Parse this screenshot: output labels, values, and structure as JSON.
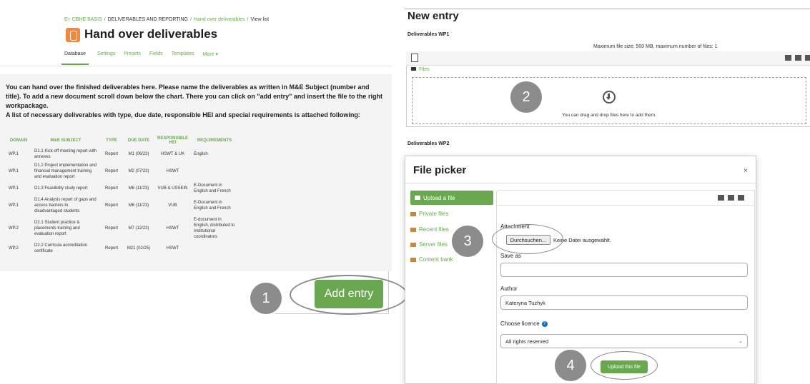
{
  "left": {
    "breadcrumb": [
      "E+ CBHE BASIS",
      "DELIVERABLES AND REPORTING",
      "Hand over deliverables",
      "View list"
    ],
    "breadcrumb_sep": "/",
    "title": "Hand over deliverables",
    "tabs": [
      "Database",
      "Settings",
      "Presets",
      "Fields",
      "Templates",
      "More ▾"
    ],
    "intro_p1": "You can hand over the finished deliverables here. Please name the deliverables as written in M&E Subject (number and title). To add a new document scroll down below the chart. There you can click on \"add entry\" and insert the file to the right workpackage.",
    "intro_p2": "A list of necessary deliverables with type, due date, responsible HEI and special requirements is attached following:",
    "table": {
      "headers": [
        "DOMAIN",
        "M&E SUBJECT",
        "TYPE",
        "DUE DATE",
        "RESPONSIBLE HEI",
        "REQUIREMENTS"
      ],
      "rows": [
        [
          "WP.1",
          "D1.1 Kick-off meeting report with annexes",
          "Report",
          "M1 (06/23)",
          "HSWT & UK",
          "English"
        ],
        [
          "WP.1",
          "D1.2 Project implementation and financial management training and evaluation report",
          "Report",
          "M2 (07/23)",
          "HSWT",
          ""
        ],
        [
          "WP.1",
          "D1.3 Feasibility study report",
          "Report",
          "M6 (11/23)",
          "VUB & USSEIN",
          "E-Document in English and French"
        ],
        [
          "WP.1",
          "D1.4 Analysis report of gaps and access barriers to disadvantaged students",
          "Report",
          "M6 (11/23)",
          "VUB",
          "E-Document in English and French"
        ],
        [
          "WP.2",
          "D2.1 Student practice & placements training and evaluation report",
          "Report",
          "M7 (12/23)",
          "HSWT",
          "E-document in English, distributed to institutional coordinators"
        ],
        [
          "WP.2",
          "D2.2 Curricula accreditation certificate",
          "Report",
          "M21 (02/25)",
          "HSWT",
          ""
        ]
      ]
    },
    "add_entry_label": "Add entry"
  },
  "steps": [
    "1",
    "2",
    "3",
    "4"
  ],
  "right": {
    "title": "New entry",
    "wp1_label": "Deliverables WP1",
    "max_size": "Maximum file size: 500 MB, maximum number of files: 1",
    "files_folder": "Files",
    "drop_text": "You can drag and drop files here to add them.",
    "wp2_label": "Deliverables WP2"
  },
  "file_picker": {
    "title": "File picker",
    "close": "×",
    "sidebar": [
      "Upload a file",
      "Private files",
      "Recent files",
      "Server files",
      "Content bank"
    ],
    "attachment_label": "Attachment",
    "choose_button": "Durchsuchen...",
    "no_file": "Keine Datei ausgewählt.",
    "save_as_label": "Save as",
    "save_as_value": "",
    "author_label": "Author",
    "author_value": "Kateryna Tuzhyk",
    "licence_label": "Choose licence",
    "licence_value": "All rights reserved",
    "upload_button": "Upload this file"
  },
  "colors": {
    "accent": "#6aa84f",
    "step_bubble": "#8c8c8c",
    "db_icon": "#f0883e"
  }
}
